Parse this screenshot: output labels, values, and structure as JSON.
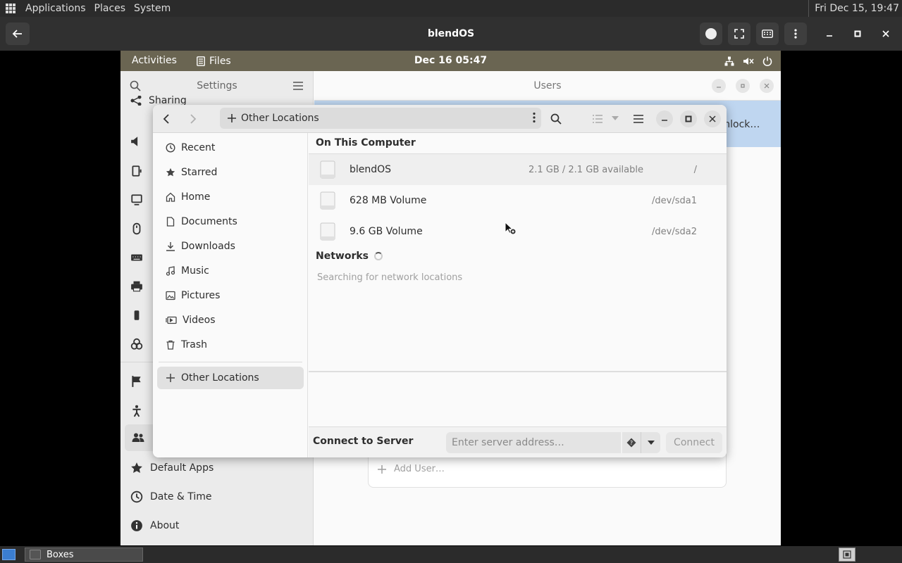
{
  "host": {
    "menu": [
      "Applications",
      "Places",
      "System"
    ],
    "clock": "Fri Dec 15, 19:47"
  },
  "boxes": {
    "title": "blendOS"
  },
  "guest": {
    "activities": "Activities",
    "app_name": "Files",
    "clock": "Dec 16  05:47"
  },
  "settings": {
    "title": "Settings",
    "partial_item": "Sharing",
    "items": [
      {
        "label": "Default Apps",
        "icon": "star-icon"
      },
      {
        "label": "Date & Time",
        "icon": "clock-icon"
      },
      {
        "label": "About",
        "icon": "info-icon"
      }
    ]
  },
  "users": {
    "title": "Users",
    "unlock_label": "Unlock…",
    "add_user": "Add User…"
  },
  "files": {
    "path_label": "Other Locations",
    "places": [
      {
        "label": "Recent",
        "icon": "recent-icon"
      },
      {
        "label": "Starred",
        "icon": "star-icon"
      },
      {
        "label": "Home",
        "icon": "home-icon"
      },
      {
        "label": "Documents",
        "icon": "document-icon"
      },
      {
        "label": "Downloads",
        "icon": "download-icon"
      },
      {
        "label": "Music",
        "icon": "music-icon"
      },
      {
        "label": "Pictures",
        "icon": "picture-icon"
      },
      {
        "label": "Videos",
        "icon": "video-icon"
      },
      {
        "label": "Trash",
        "icon": "trash-icon"
      }
    ],
    "other_locations": "Other Locations",
    "on_this_computer": "On This Computer",
    "drives": [
      {
        "name": "blendOS",
        "available": "2.1 GB / 2.1 GB available",
        "mount": "/"
      },
      {
        "name": "628 MB Volume",
        "available": "",
        "mount": "/dev/sda1"
      },
      {
        "name": "9.6 GB Volume",
        "available": "",
        "mount": "/dev/sda2"
      }
    ],
    "networks": "Networks",
    "searching": "Searching for network locations",
    "connect_to_server": "Connect to Server",
    "server_placeholder": "Enter server address…",
    "connect_button": "Connect"
  },
  "taskbar": {
    "boxes_task": "Boxes"
  }
}
